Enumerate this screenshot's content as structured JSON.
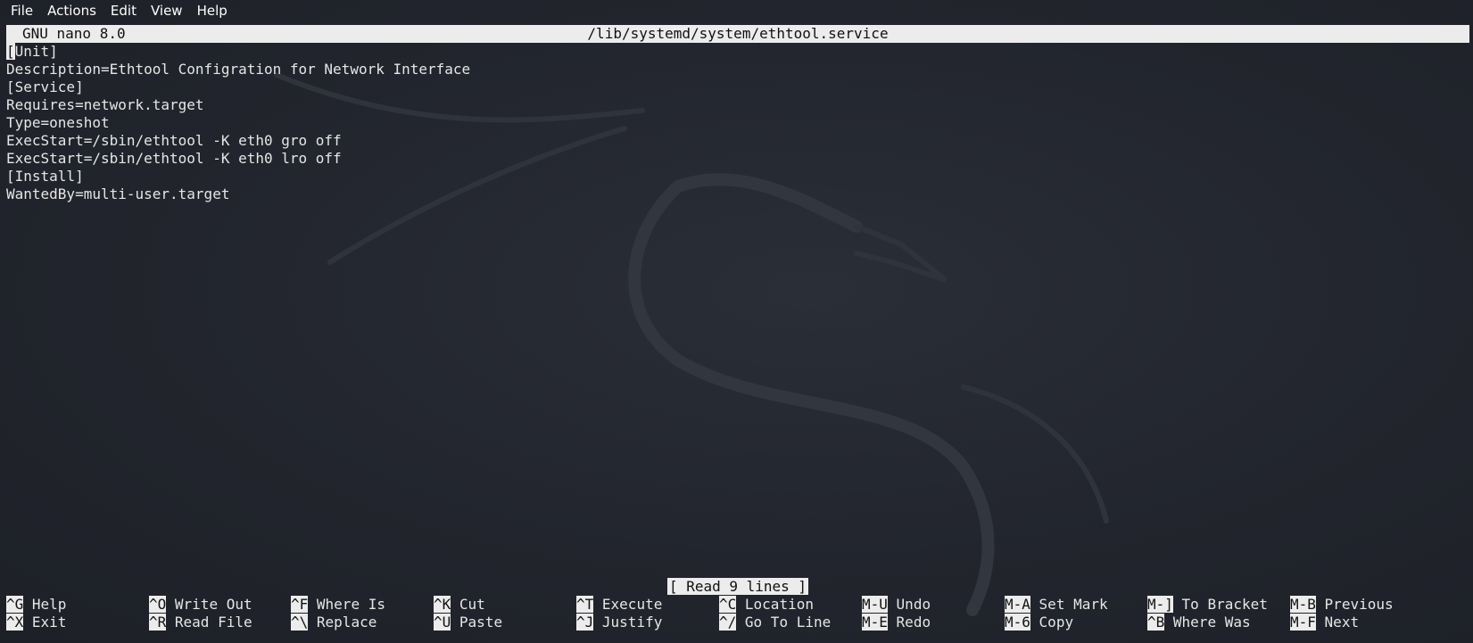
{
  "menubar": {
    "items": [
      "File",
      "Actions",
      "Edit",
      "View",
      "Help"
    ]
  },
  "nano": {
    "version": "GNU nano 8.0",
    "filename": "/lib/systemd/system/ethtool.service",
    "cursor_char": "[",
    "first_line_rest": "Unit]",
    "lines": [
      "Description=Ethtool Configration for Network Interface",
      "[Service]",
      "Requires=network.target",
      "Type=oneshot",
      "ExecStart=/sbin/ethtool -K eth0 gro off",
      "ExecStart=/sbin/ethtool -K eth0 lro off",
      "[Install]",
      "WantedBy=multi-user.target"
    ],
    "status": "[ Read 9 lines ]"
  },
  "shortcuts": {
    "row1": [
      {
        "key": "^G",
        "label": "Help"
      },
      {
        "key": "^O",
        "label": "Write Out"
      },
      {
        "key": "^F",
        "label": "Where Is"
      },
      {
        "key": "^K",
        "label": "Cut"
      },
      {
        "key": "^T",
        "label": "Execute"
      },
      {
        "key": "^C",
        "label": "Location"
      },
      {
        "key": "M-U",
        "label": "Undo"
      },
      {
        "key": "M-A",
        "label": "Set Mark"
      },
      {
        "key": "M-]",
        "label": "To Bracket"
      },
      {
        "key": "M-B",
        "label": "Previous"
      }
    ],
    "row2": [
      {
        "key": "^X",
        "label": "Exit"
      },
      {
        "key": "^R",
        "label": "Read File"
      },
      {
        "key": "^\\",
        "label": "Replace"
      },
      {
        "key": "^U",
        "label": "Paste"
      },
      {
        "key": "^J",
        "label": "Justify"
      },
      {
        "key": "^/",
        "label": "Go To Line"
      },
      {
        "key": "M-E",
        "label": "Redo"
      },
      {
        "key": "M-6",
        "label": "Copy"
      },
      {
        "key": "^B",
        "label": "Where Was"
      },
      {
        "key": "M-F",
        "label": "Next"
      }
    ]
  },
  "colors": {
    "background": "#23262e",
    "inverse_bg": "#ececec",
    "text": "#e6e6e6"
  }
}
